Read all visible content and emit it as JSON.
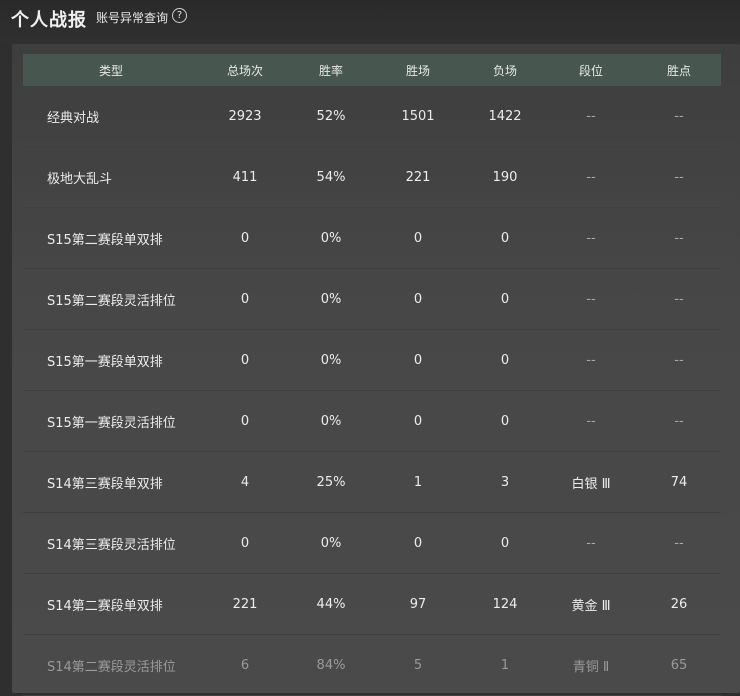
{
  "header": {
    "title": "个人战报",
    "sub_link": "账号异常查询",
    "help_symbol": "?"
  },
  "table": {
    "columns": [
      "类型",
      "总场次",
      "胜率",
      "胜场",
      "负场",
      "段位",
      "胜点"
    ],
    "rows": [
      [
        "经典对战",
        "2923",
        "52%",
        "1501",
        "1422",
        "--",
        "--"
      ],
      [
        "极地大乱斗",
        "411",
        "54%",
        "221",
        "190",
        "--",
        "--"
      ],
      [
        "S15第二赛段单双排",
        "0",
        "0%",
        "0",
        "0",
        "--",
        "--"
      ],
      [
        "S15第二赛段灵活排位",
        "0",
        "0%",
        "0",
        "0",
        "--",
        "--"
      ],
      [
        "S15第一赛段单双排",
        "0",
        "0%",
        "0",
        "0",
        "--",
        "--"
      ],
      [
        "S15第一赛段灵活排位",
        "0",
        "0%",
        "0",
        "0",
        "--",
        "--"
      ],
      [
        "S14第三赛段单双排",
        "4",
        "25%",
        "1",
        "3",
        "白银 Ⅲ",
        "74"
      ],
      [
        "S14第三赛段灵活排位",
        "0",
        "0%",
        "0",
        "0",
        "--",
        "--"
      ],
      [
        "S14第二赛段单双排",
        "221",
        "44%",
        "97",
        "124",
        "黄金 Ⅲ",
        "26"
      ],
      [
        "S14第二赛段灵活排位",
        "6",
        "84%",
        "5",
        "1",
        "青铜 Ⅱ",
        "65"
      ]
    ]
  }
}
